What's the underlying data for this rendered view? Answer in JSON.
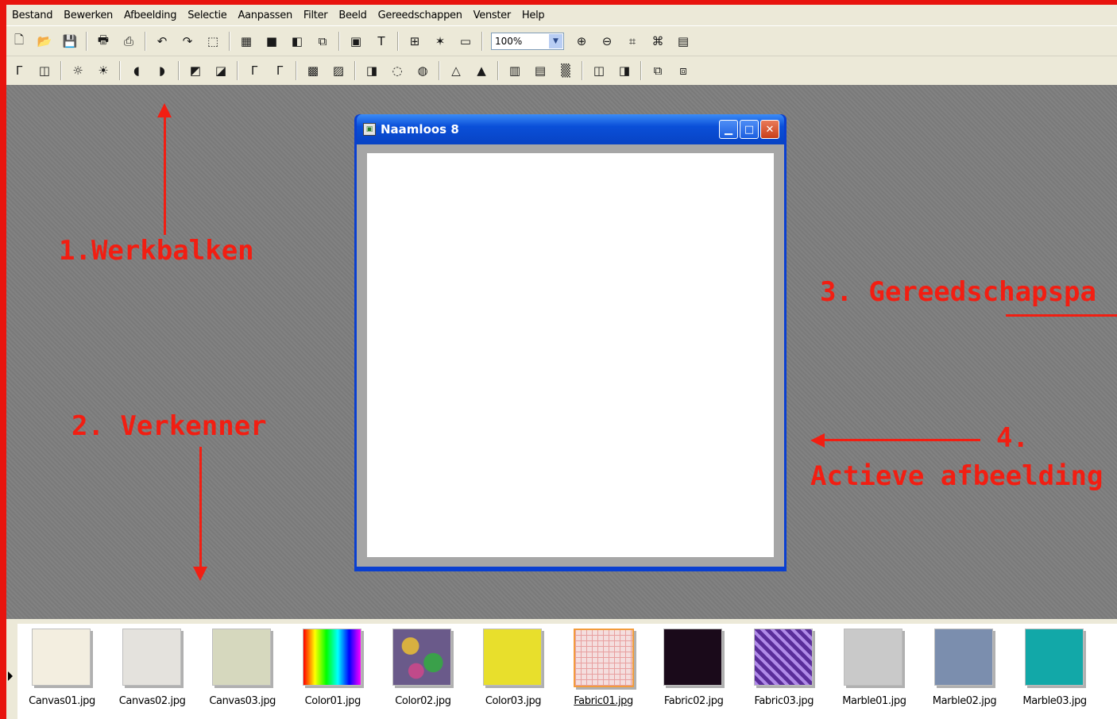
{
  "menu": [
    "Bestand",
    "Bewerken",
    "Afbeelding",
    "Selectie",
    "Aanpassen",
    "Filter",
    "Beeld",
    "Gereedschappen",
    "Venster",
    "Help"
  ],
  "toolbar1": {
    "icons": [
      "new-file-icon",
      "open-icon",
      "save-icon",
      "print-icon",
      "scan-icon",
      "undo-icon",
      "redo-icon",
      "crop-icon",
      "layers-icon",
      "color-palette-icon",
      "contrast-icon",
      "resize-icon",
      "image-icon",
      "text-icon",
      "browse-icon",
      "effects-icon",
      "window-icon"
    ],
    "zoom_value": "100%",
    "zoom_icons": [
      "zoom-in-icon",
      "zoom-out-icon",
      "fit-icon",
      "fit-window-icon",
      "fullscreen-icon"
    ]
  },
  "toolbar2": {
    "icons": [
      "auto-levels-icon",
      "auto-contrast-icon",
      "brightness-icon",
      "brightness-plus-icon",
      "gamma-icon",
      "gamma-plus-icon",
      "color-balance-icon",
      "color-balance-plus-icon",
      "curve-icon",
      "curve-plus-icon",
      "histogram-icon",
      "histogram-eq-icon",
      "sharpen-icon",
      "blur-icon",
      "soften-icon",
      "drop-icon",
      "drop-plus-icon",
      "rgb-icon",
      "hsl-icon",
      "noise-icon",
      "flip-icon",
      "mirror-icon",
      "copy-icon",
      "paste-icon"
    ]
  },
  "window": {
    "title": "Naamloos 8"
  },
  "annotations": {
    "a1": "1.Werkbalken",
    "a2": "2. Verkenner",
    "a3": "3. Gereedschapspa",
    "a4_num": "4.",
    "a4_text": "Actieve afbeelding"
  },
  "browser": {
    "thumbnails": [
      {
        "label": "Canvas01.jpg",
        "color": "#f3eee0"
      },
      {
        "label": "Canvas02.jpg",
        "color": "#e4e2dd"
      },
      {
        "label": "Canvas03.jpg",
        "color": "#d6d8be"
      },
      {
        "label": "Color01.jpg",
        "color": "rainbow"
      },
      {
        "label": "Color02.jpg",
        "color": "#6a5a8a"
      },
      {
        "label": "Color03.jpg",
        "color": "#e8df2c"
      },
      {
        "label": "Fabric01.jpg",
        "color": "#f4dede",
        "selected": true
      },
      {
        "label": "Fabric02.jpg",
        "color": "#1a0a1a"
      },
      {
        "label": "Fabric03.jpg",
        "color": "#7c4fb8"
      },
      {
        "label": "Marble01.jpg",
        "color": "#c9c9c9"
      },
      {
        "label": "Marble02.jpg",
        "color": "#7b8eae"
      },
      {
        "label": "Marble03.jpg",
        "color": "#12a8a8"
      }
    ]
  }
}
